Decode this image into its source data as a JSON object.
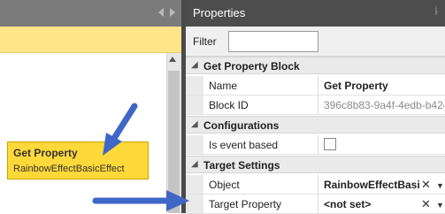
{
  "properties": {
    "title": "Properties",
    "filter_label": "Filter",
    "filter_value": ""
  },
  "sections": {
    "get_property_block": "Get Property Block",
    "configurations": "Configurations",
    "target_settings": "Target Settings"
  },
  "rows": {
    "name": {
      "label": "Name",
      "value": "Get Property"
    },
    "block_id": {
      "label": "Block ID",
      "value": "396c8b83-9a4f-4edb-b42c"
    },
    "is_event_based": {
      "label": "Is event based",
      "checked": false
    },
    "object": {
      "label": "Object",
      "value": "RainbowEffectBasi"
    },
    "target_property": {
      "label": "Target Property",
      "value": "<not set>"
    }
  },
  "node": {
    "title": "Get Property",
    "subtitle": "RainbowEffectBasicEffect"
  },
  "glyphs": {
    "expand_caret": "◢",
    "clear": "✕",
    "dropdown": "▼",
    "pin": "ᚿ"
  },
  "colors": {
    "node_fill": "#ffd83a",
    "arrow": "#3f67c6",
    "panel_header": "#4d4d4d"
  }
}
